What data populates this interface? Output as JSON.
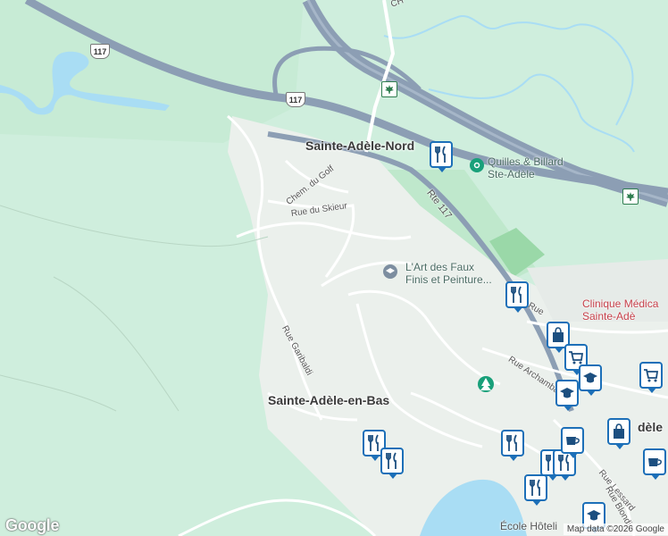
{
  "places": {
    "sainte_adele_nord": "Sainte-Adèle-Nord",
    "sainte_adele_en_bas": "Sainte-Adèle-en-Bas",
    "adele_partial": "dèle"
  },
  "streets": {
    "chem_du_golf": "Chem. du Golf",
    "rue_du_skieur": "Rue du Skieur",
    "rte_117": "Rte 117",
    "rue_garibaldi": "Rue Garibaldi",
    "rue_archambault": "Rue Archambault",
    "rue_lessard": "Rue Lessard",
    "rue_blondin": "Rue Blondin",
    "ch_top": "CH",
    "rue_partial": "Rue"
  },
  "route_shields": [
    "117",
    "117"
  ],
  "pois": {
    "quilles": [
      "Quilles & Billard",
      "Ste-Adèle"
    ],
    "art_des_faux": [
      "L'Art des Faux",
      "Finis et Peinture..."
    ],
    "clinique": [
      "Clinique Médica",
      "Sainte-Adè"
    ],
    "ecole": "École Hôteli"
  },
  "map_pins": [
    "restaurant",
    "restaurant",
    "restaurant",
    "restaurant",
    "restaurant",
    "restaurant",
    "restaurant",
    "restaurant",
    "shopping-bag",
    "shopping-cart",
    "school",
    "school",
    "school",
    "cafe",
    "cafe",
    "shopping-bag",
    "shopping-cart"
  ],
  "colors": {
    "land": "#cfeedd",
    "water": "#a9ddf4",
    "park": "#b7e6c5",
    "highway": "#8c9eb4",
    "road": "#ffffff",
    "pin_border": "#1c6fb8"
  },
  "footer": {
    "logo": "Google",
    "attribution": "Map data ©2026 Google"
  }
}
